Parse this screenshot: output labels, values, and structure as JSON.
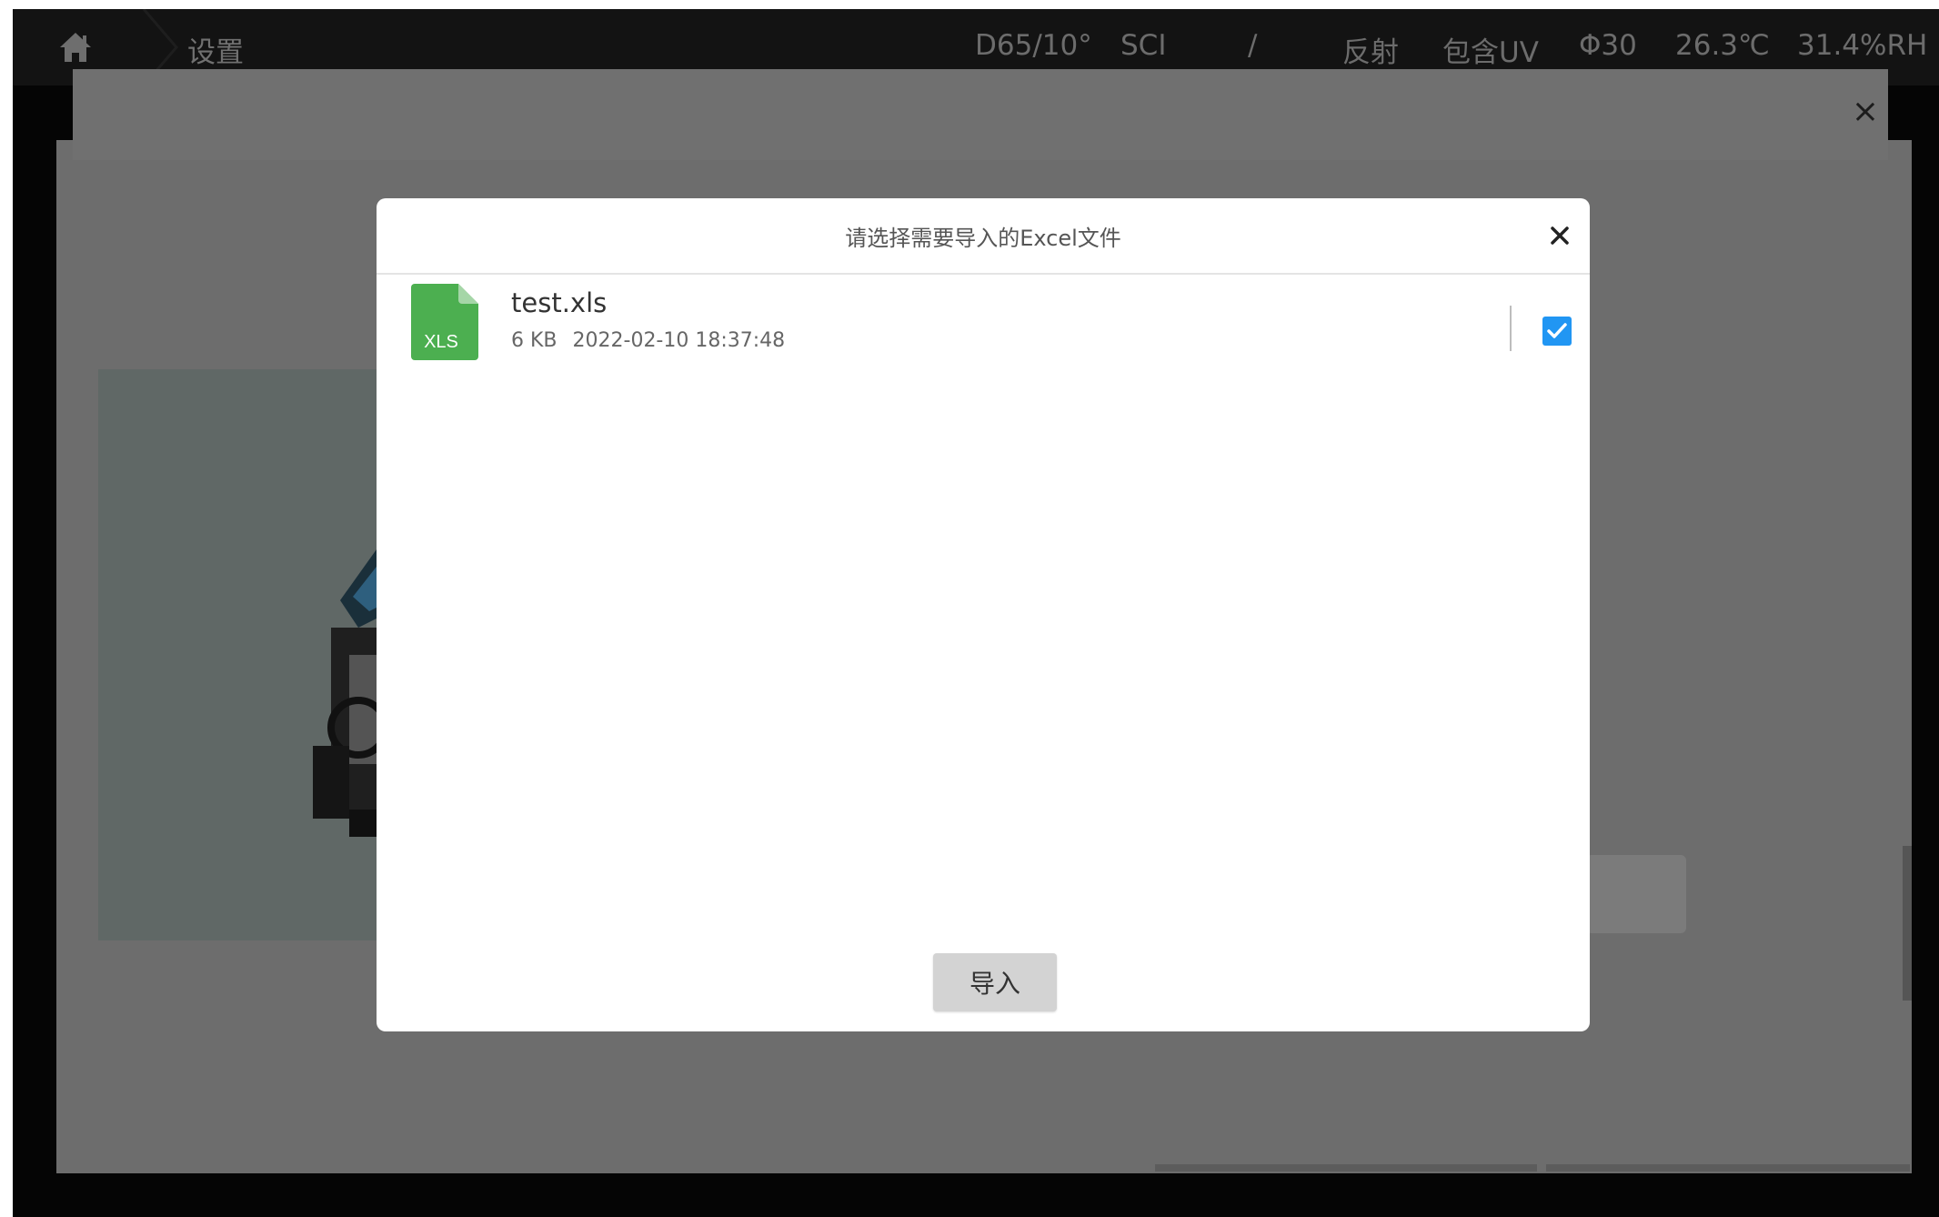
{
  "topbar": {
    "title": "设置",
    "status": {
      "illuminant": "D65/10°",
      "mode": "SCI",
      "separator": "/",
      "measure_type": "反射",
      "uv": "包含UV",
      "aperture": "Φ30",
      "temperature": "26.3℃",
      "humidity": "31.4%RH"
    }
  },
  "dialog": {
    "title": "请选择需要导入的Excel文件",
    "files": [
      {
        "icon_label": "XLS",
        "name": "test.xls",
        "size": "6 KB",
        "modified": "2022-02-10 18:37:48",
        "checked": true
      }
    ],
    "import_label": "导入"
  },
  "background": {
    "close_glyph": "×"
  },
  "colors": {
    "accent": "#2196f3",
    "file_icon": "#4caf50"
  }
}
